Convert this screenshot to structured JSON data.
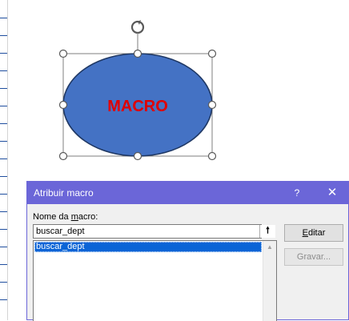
{
  "shape": {
    "text": "MACRO",
    "fill_color": "#4472c4",
    "outline_color": "#1f3864",
    "text_color": "#e00000",
    "rotate_handle_icon": "rotate-icon"
  },
  "dialog": {
    "title": "Atribuir macro",
    "help_label": "?",
    "close_label": "✕",
    "title_color": "#6b66d8",
    "macro_name_label_prefix": "Nome da ",
    "macro_name_label_accel": "m",
    "macro_name_label_suffix": "acro:",
    "macro_name_value": "buscar_dept",
    "macro_list": [
      "buscar_dept"
    ],
    "upload_icon_glyph": "🠕",
    "buttons": {
      "edit_accel": "E",
      "edit_rest": "ditar",
      "record_label": "Gravar..."
    }
  }
}
